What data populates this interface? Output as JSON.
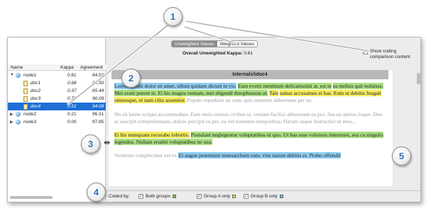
{
  "segmented": {
    "unweighted": "Unweighted Values",
    "weighted": "Weighted Values"
  },
  "overall": {
    "label": "Overall Unweighted Kappa:",
    "value": "0.61"
  },
  "show_coding": {
    "label_line1": "Show coding",
    "label_line2": "comparison content",
    "checked": "✓"
  },
  "table": {
    "headers": {
      "name": "Name",
      "kappa": "Kappa",
      "agreement": "Agreement"
    },
    "rows": [
      {
        "name": "node1",
        "kappa": "0.61",
        "agreement": "84.53",
        "type": "node"
      },
      {
        "name": "doc1",
        "kappa": "0.68",
        "agreement": "88.50",
        "type": "doc"
      },
      {
        "name": "doc2",
        "kappa": "0.37",
        "agreement": "65.44",
        "type": "doc"
      },
      {
        "name": "doc3",
        "kappa": "0.70",
        "agreement": "90.09",
        "type": "doc"
      },
      {
        "name": "doc4",
        "kappa": "0.51",
        "agreement": "94.08",
        "type": "doc"
      },
      {
        "name": "node2",
        "kappa": "0.21",
        "agreement": "96.31",
        "type": "node"
      },
      {
        "name": "node3",
        "kappa": "0.00",
        "agreement": "97.85",
        "type": "node"
      }
    ]
  },
  "document": {
    "title": "Internals\\\\doc4",
    "p1": {
      "a": "Lorem ipsum dolor sit amet, ullum quidam dicunt in vis.",
      "b": "Eum everti mentitum delicatissimi at, est te",
      "c": "ea melius quit noluisse. Mei erant putent te. Ei his magna veniam, mei eligendi theophrastus at.",
      "d": "Tale",
      "e": "tantas accusamus ei has. Eum ut debitis feugait omnesque, ei nam clita assentior.",
      "f": "Populo repudiare an cum, quis omnium abhorreant per no."
    },
    "p2": "No sit latine scripta accommodare. Eam meis ceteros civibus te, veniam facilisi abhorreant ea pro. Sea ea option iisque. Duo at suscipit comprehensam, dolore percipit cu per, ea vel nonumes temporibus. Harum usque instructior ut mea....",
    "p3": {
      "a": "Ei his numquam recusabo lobortis.",
      "b": "Postulant neglegentur voluptatibus ut quo. Ut has esse volumus interesset, sea cu singulis legendos. Nullam eruditi voluptatibus ne usu."
    },
    "p4": {
      "a": "Verterem complectitur vel et.",
      "b": "Ei augue petentium mnesarchum eam, vim natum debitis et. Probo offendit"
    }
  },
  "coded_by": {
    "label": "Coded by:",
    "both": "Both groups",
    "a_only": "Group A only",
    "b_only": "Group B only",
    "colors": {
      "both": "#7dc94a",
      "a": "#f2d22a",
      "b": "#5fb4ea"
    }
  },
  "callouts": [
    "1",
    "2",
    "3",
    "4",
    "5"
  ]
}
